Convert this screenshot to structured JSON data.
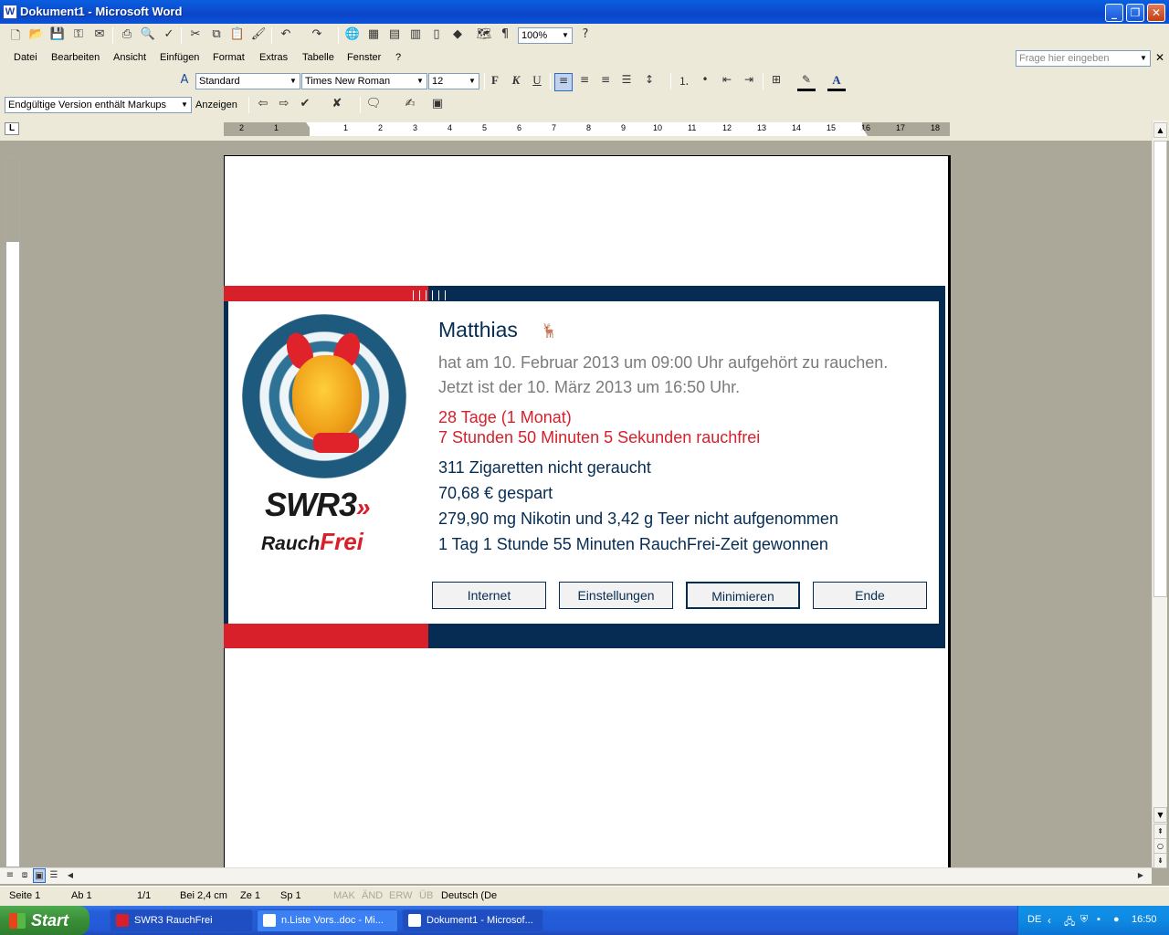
{
  "window": {
    "title": "Dokument1 - Microsoft Word",
    "min": "_",
    "max": "❐",
    "close": "✕"
  },
  "toolbar1": {
    "zoom": "100%"
  },
  "menu": {
    "items": [
      "Datei",
      "Bearbeiten",
      "Ansicht",
      "Einfügen",
      "Format",
      "Extras",
      "Tabelle",
      "Fenster",
      "?"
    ],
    "help_placeholder": "Frage hier eingeben",
    "close": "✕"
  },
  "format": {
    "style": "Standard",
    "font": "Times New Roman",
    "size": "12",
    "bold": "F",
    "italic": "K",
    "underline": "U"
  },
  "review": {
    "markup": "Endgültige Version enthält Markups",
    "show": "Anzeigen"
  },
  "ruler": {
    "corner": "L",
    "marks": [
      "2",
      "1",
      "1",
      "2",
      "3",
      "4",
      "5",
      "6",
      "7",
      "8",
      "9",
      "10",
      "11",
      "12",
      "13",
      "14",
      "15",
      "16",
      "17",
      "18"
    ]
  },
  "popup": {
    "name": "Matthias",
    "line1": "hat am 10. Februar 2013 um 09:00 Uhr aufgehört zu rauchen.",
    "line2": "Jetzt ist der 10. März 2013 um 16:50 Uhr.",
    "days": "28 Tage   (1 Monat)",
    "time": "7 Stunden  50 Minuten  5 Sekunden  rauchfrei",
    "cigarettes": "311 Zigaretten nicht geraucht",
    "saved": "70,68 € gespart",
    "nicotine": "279,90 mg  Nikotin und 3,42 g  Teer nicht aufgenommen",
    "gained": "1 Tag  1 Stunde  55 Minuten  RauchFrei-Zeit gewonnen",
    "logo_swr": "SWR3",
    "logo_rauch": "Rauch",
    "logo_frei": "Frei",
    "buttons": [
      "Internet",
      "Einstellungen",
      "Minimieren",
      "Ende"
    ]
  },
  "status": {
    "page": "Seite  1",
    "section": "Ab  1",
    "pages": "1/1",
    "at": "Bei  2,4 cm",
    "line": "Ze  1",
    "col": "Sp  1",
    "mak": "MAK",
    "aend": "ÄND",
    "erw": "ERW",
    "ueb": "ÜB",
    "lang": "Deutsch (De"
  },
  "taskbar": {
    "start": "Start",
    "tasks": [
      "SWR3 RauchFrei",
      "n.Liste Vors..doc - Mi...",
      "Dokument1 - Microsof..."
    ],
    "lang": "DE",
    "clock": "16:50"
  }
}
